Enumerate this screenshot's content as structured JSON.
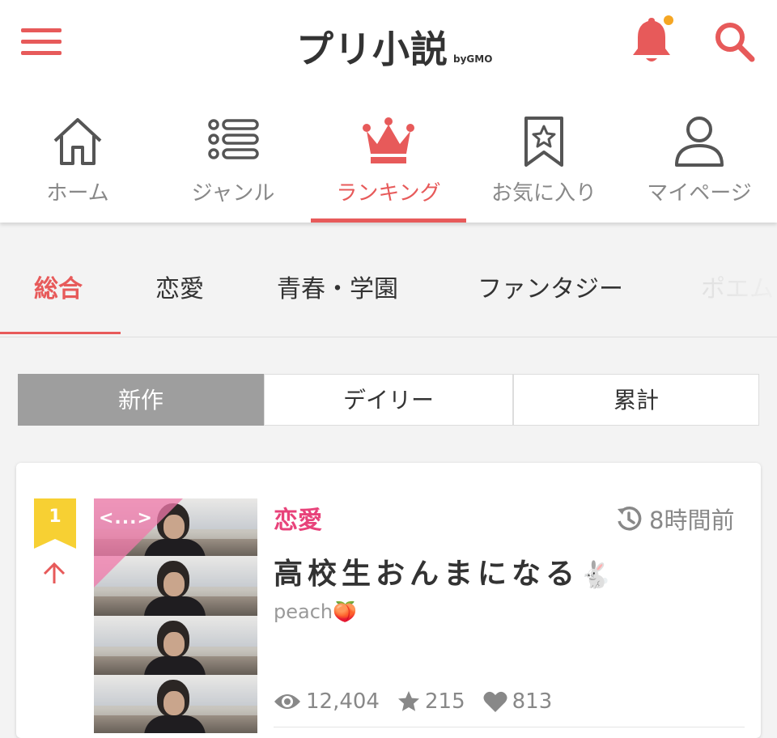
{
  "header": {
    "logo": "プリ小説",
    "logo_sub": "byGMO"
  },
  "colors": {
    "accent": "#e75a5a",
    "notification_dot": "#f5a623",
    "rank_badge": "#f7d033",
    "genre_pink": "#e8427a"
  },
  "nav": {
    "items": [
      {
        "label": "ホーム",
        "icon": "home-icon"
      },
      {
        "label": "ジャンル",
        "icon": "list-icon"
      },
      {
        "label": "ランキング",
        "icon": "crown-icon",
        "active": true
      },
      {
        "label": "お気に入り",
        "icon": "bookmark-star-icon"
      },
      {
        "label": "マイページ",
        "icon": "user-icon"
      }
    ]
  },
  "genre_tabs": [
    {
      "label": "総合",
      "active": true
    },
    {
      "label": "恋愛"
    },
    {
      "label": "青春・学園"
    },
    {
      "label": "ファンタジー"
    },
    {
      "label": "ポエム"
    }
  ],
  "period_tabs": [
    {
      "label": "新作",
      "active": true
    },
    {
      "label": "デイリー"
    },
    {
      "label": "累計"
    }
  ],
  "ranking": [
    {
      "rank": "1",
      "trend": "up",
      "cover_code": "<...>",
      "genre": "恋愛",
      "time_ago": "8時間前",
      "title": "高校生おんまになる",
      "title_emoji": "🐇",
      "author": "peach",
      "author_emoji": "🍑",
      "views": "12,404",
      "stars": "215",
      "likes": "813"
    }
  ]
}
